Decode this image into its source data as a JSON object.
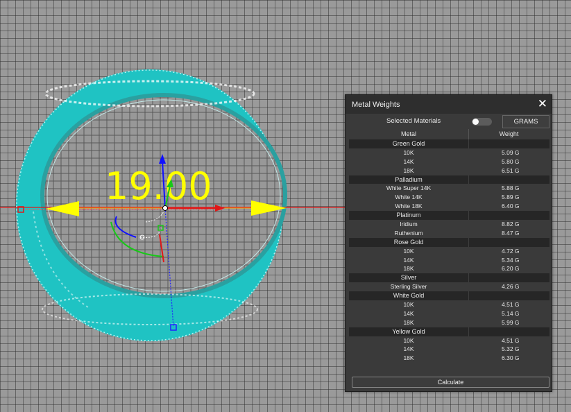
{
  "viewport": {
    "dimension_label": "19.00",
    "colors": {
      "ring": "#1fc3c3",
      "grid_bg": "#9a9a9a",
      "grid_line": "#2e2e2e",
      "x_axis": "#e01818",
      "y_axis": "#1010ff",
      "z_axis": "#18c818",
      "dimension": "#ffff00"
    }
  },
  "panel": {
    "title": "Metal Weights",
    "close_label": "✕",
    "selected_materials_label": "Selected Materials",
    "unit_button": "GRAMS",
    "columns": {
      "metal": "Metal",
      "weight": "Weight"
    },
    "groups": [
      {
        "name": "Green Gold",
        "items": [
          {
            "name": "10K",
            "weight": "5.09 G"
          },
          {
            "name": "14K",
            "weight": "5.80 G"
          },
          {
            "name": "18K",
            "weight": "6.51 G"
          }
        ]
      },
      {
        "name": "Palladium",
        "items": [
          {
            "name": "White Super 14K",
            "weight": "5.88 G"
          },
          {
            "name": "White 14K",
            "weight": "5.89 G"
          },
          {
            "name": "White 18K",
            "weight": "6.40 G"
          }
        ]
      },
      {
        "name": "Platinum",
        "items": [
          {
            "name": "Iridium",
            "weight": "8.82 G"
          },
          {
            "name": "Ruthenium",
            "weight": "8.47 G"
          }
        ]
      },
      {
        "name": "Rose Gold",
        "items": [
          {
            "name": "10K",
            "weight": "4.72 G"
          },
          {
            "name": "14K",
            "weight": "5.34 G"
          },
          {
            "name": "18K",
            "weight": "6.20 G"
          }
        ]
      },
      {
        "name": "Silver",
        "items": [
          {
            "name": "Sterling Silver",
            "weight": "4.26 G"
          }
        ]
      },
      {
        "name": "White Gold",
        "items": [
          {
            "name": "10K",
            "weight": "4.51 G"
          },
          {
            "name": "14K",
            "weight": "5.14 G"
          },
          {
            "name": "18K",
            "weight": "5.99 G"
          }
        ]
      },
      {
        "name": "Yellow Gold",
        "items": [
          {
            "name": "10K",
            "weight": "4.51 G"
          },
          {
            "name": "14K",
            "weight": "5.32 G"
          },
          {
            "name": "18K",
            "weight": "6.30 G"
          }
        ]
      }
    ],
    "calculate_label": "Calculate"
  }
}
